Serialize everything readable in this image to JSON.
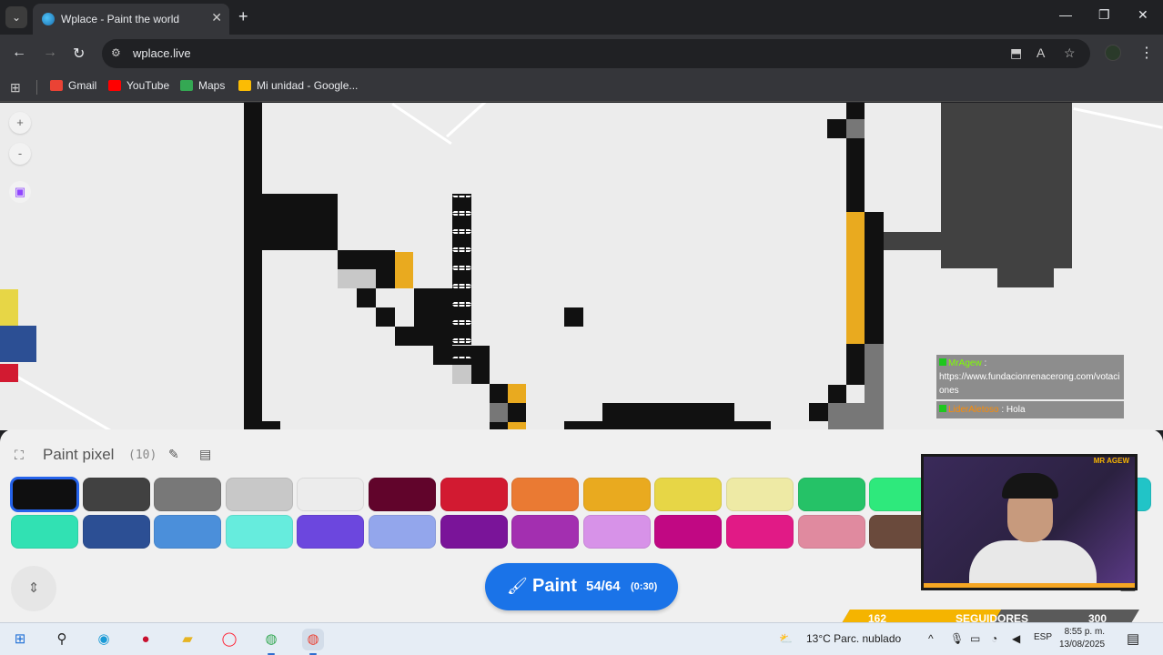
{
  "browser": {
    "tab_title": "Wplace - Paint the world",
    "tab_close": "✕",
    "new_tab": "+",
    "url": "wplace.live",
    "window_controls": {
      "minimize": "—",
      "restore": "❐",
      "close": "✕"
    }
  },
  "bookmarks": [
    {
      "label": "Gmail",
      "color": "#ea4335"
    },
    {
      "label": "YouTube",
      "color": "#ff0000"
    },
    {
      "label": "Maps",
      "color": "#34a853"
    },
    {
      "label": "Mi unidad - Google...",
      "color": "#fbbc04"
    }
  ],
  "map_controls": {
    "zoom_in": "+",
    "zoom_out": "-"
  },
  "chat": [
    {
      "user": "MrAgew",
      "sep": ":",
      "text": "https://www.fundacionrenacerong.com/votaciones",
      "user_color": "#7fff00"
    },
    {
      "user": "LiderAletoso",
      "sep": ":",
      "text": " Hola",
      "user_color": "#ff8c00"
    }
  ],
  "paint_panel": {
    "title": "Paint pixel",
    "count": "(10)",
    "palette_row1": [
      "#0f0f10",
      "#414141",
      "#787878",
      "#c8c8c8",
      "#ececec",
      "#61042b",
      "#d21a31",
      "#ea7a33",
      "#e9aa1f",
      "#e7d646",
      "#eeeaa5",
      "#25c267",
      "#2ee97c",
      "#1bdb9f",
      "#12c0b6",
      "#21c4c7"
    ],
    "palette_row2": [
      "#31e1b3",
      "#2c4f94",
      "#4b8fda",
      "#66ecdd",
      "#6c47de",
      "#93a6ec",
      "#7a1499",
      "#a32fb0",
      "#d792e8",
      "#c10883",
      "#e11a86",
      "#e08a9f",
      "#6a4a3c"
    ],
    "selected_index": 0,
    "paint_label": "Paint",
    "charges": "54/64",
    "cooldown": "(0:30)"
  },
  "stream_overlay": {
    "webcam_tag": "MR AGEW",
    "followers_current": "162",
    "followers_label": "SEGUIDORES",
    "followers_goal": "300",
    "followers_progress": 0.54
  },
  "taskbar": {
    "weather": "13°C  Parc. nublado",
    "language": "ESP",
    "time": "8:55 p. m.",
    "date": "13/08/2025"
  },
  "colors": {
    "accent": "#1a73e8",
    "map_bg": "#ececec",
    "gold": "#e9aa1f"
  }
}
